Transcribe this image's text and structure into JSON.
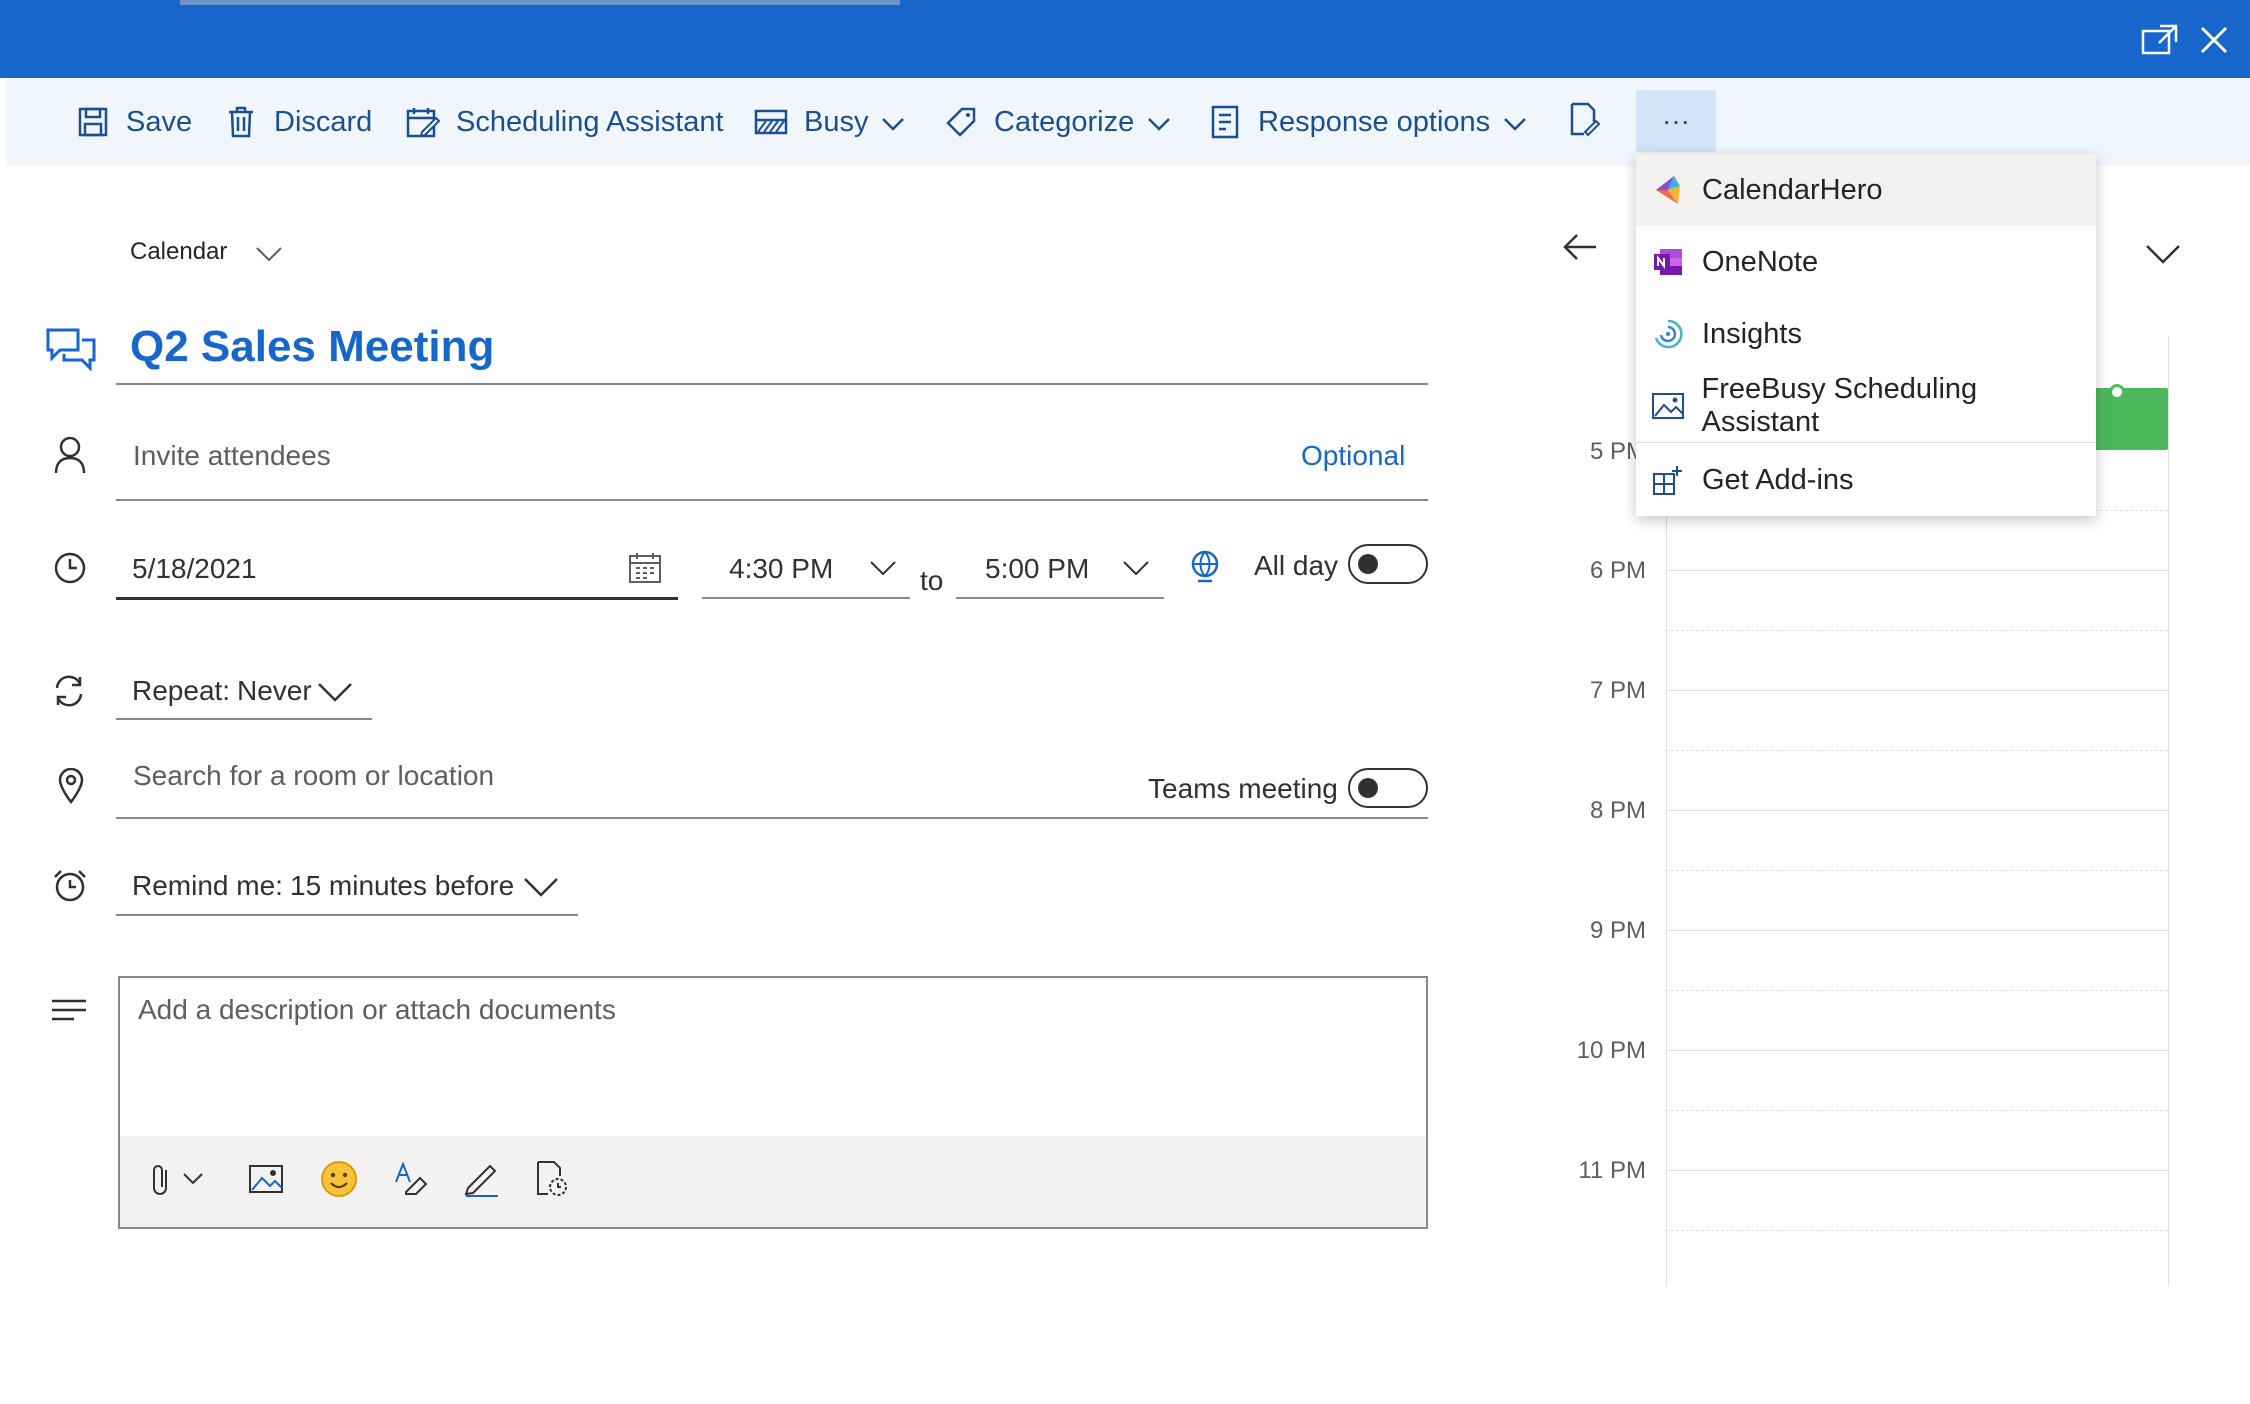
{
  "toolbar": {
    "save": "Save",
    "discard": "Discard",
    "scheduling_assistant": "Scheduling Assistant",
    "show_as": "Busy",
    "categorize": "Categorize",
    "response_options": "Response options",
    "more": "···"
  },
  "form": {
    "calendar_label": "Calendar",
    "title": "Q2 Sales Meeting",
    "attendees_placeholder": "Invite attendees",
    "optional_link": "Optional",
    "date": "5/18/2021",
    "start_time": "4:30 PM",
    "to_label": "to",
    "end_time": "5:00 PM",
    "all_day_label": "All day",
    "all_day_on": false,
    "repeat_label": "Repeat:",
    "repeat_value": "Never",
    "location_placeholder": "Search for a room or location",
    "teams_meeting_label": "Teams meeting",
    "teams_meeting_on": false,
    "remind_label": "Remind me:",
    "remind_value": "15 minutes before",
    "description_placeholder": "Add a description or attach documents"
  },
  "more_menu": {
    "items": [
      {
        "label": "CalendarHero",
        "icon": "calendarhero-icon"
      },
      {
        "label": "OneNote",
        "icon": "onenote-icon"
      },
      {
        "label": "Insights",
        "icon": "insights-icon"
      },
      {
        "label": "FreeBusy Scheduling Assistant",
        "icon": "freebusy-icon"
      },
      {
        "label": "Get Add-ins",
        "icon": "add-ins-icon"
      }
    ]
  },
  "day_view": {
    "times": [
      "5 PM",
      "6 PM",
      "7 PM",
      "8 PM",
      "9 PM",
      "10 PM",
      "11 PM"
    ],
    "event_color": "#4cb85c"
  },
  "colors": {
    "brand_blue": "#1766cc",
    "toolbar_bg": "#f1f6fc",
    "icon_blue": "#1c4f8f"
  }
}
